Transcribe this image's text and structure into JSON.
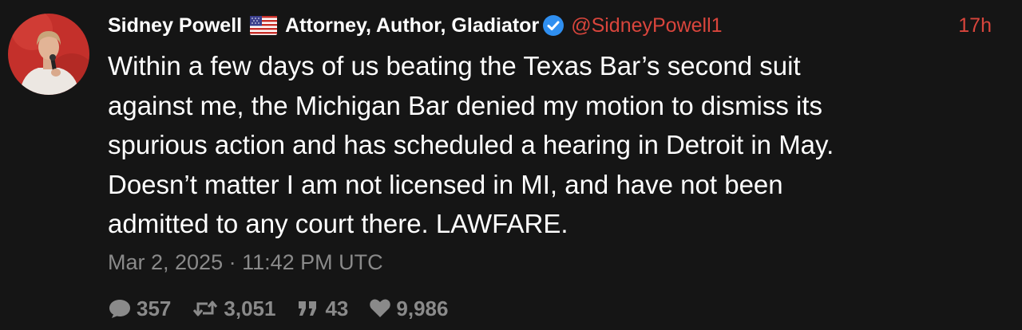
{
  "tweet": {
    "author": {
      "display_name": "Sidney Powell",
      "flag_icon": "us-flag-icon",
      "bio": "Attorney, Author, Gladiator",
      "verified_icon": "verified-badge-icon",
      "verified_color": "#2f8ff0",
      "handle": "@SidneyPowell1"
    },
    "relative_time": "17h",
    "text": "Within a few days of us beating the Texas Bar’s second suit\nagainst me, the Michigan Bar denied my motion to dismiss its\nspurious action and has scheduled a hearing in Detroit in May.\nDoesn’t matter I am not licensed in MI, and have not been\nadmitted to any court there. LAWFARE.",
    "timestamp": "Mar 2, 2025 · 11:42 PM UTC",
    "stats": {
      "replies": "357",
      "retweets": "3,051",
      "quotes": "43",
      "likes": "9,986"
    },
    "colors": {
      "background": "#151515",
      "accent": "#d9453c",
      "muted": "#8a8a8a"
    }
  }
}
